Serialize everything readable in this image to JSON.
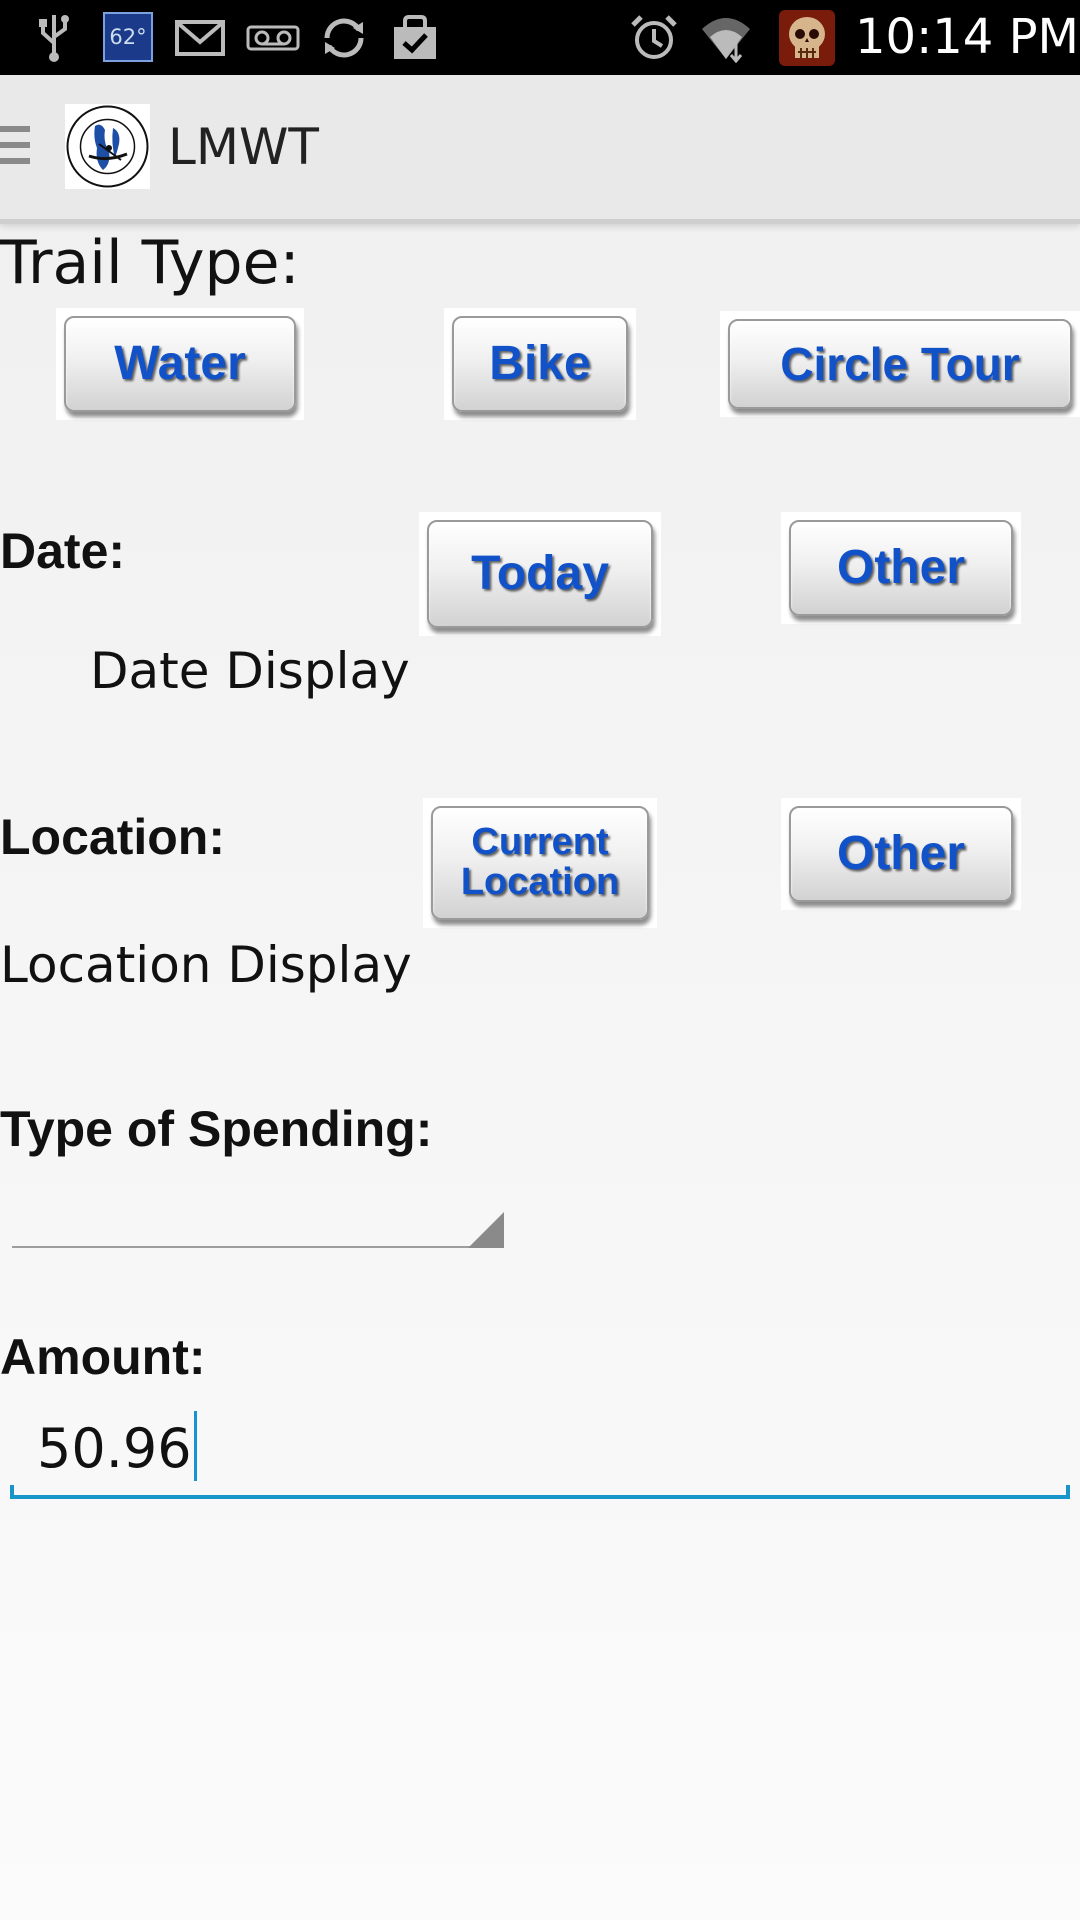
{
  "status_bar": {
    "temperature": "62°",
    "time": "10:14 PM",
    "icons": [
      "usb-icon",
      "weather-icon",
      "gmail-icon",
      "voicemail-icon",
      "sync-icon",
      "shopping-bag-icon",
      "alarm-icon",
      "wifi-icon",
      "skull-app-icon"
    ]
  },
  "action_bar": {
    "title": "LMWT",
    "logo_text": "LAKE MICHIGAN WATER TRAIL ASSOCIATION"
  },
  "form": {
    "trail_type_label": "Trail Type:",
    "trail_buttons": {
      "water": "Water",
      "bike": "Bike",
      "circle_tour": "Circle Tour"
    },
    "date_label": "Date:",
    "date_buttons": {
      "today": "Today",
      "other": "Other"
    },
    "date_display": "Date Display",
    "location_label": "Location:",
    "location_buttons": {
      "current_line1": "Current",
      "current_line2": "Location",
      "other": "Other"
    },
    "location_display": "Location Display",
    "spending_label": "Type of Spending:",
    "spending_value": "",
    "amount_label": "Amount:",
    "amount_value": "50.96"
  },
  "colors": {
    "button_text": "#1252c8",
    "field_accent": "#1a95c9"
  }
}
